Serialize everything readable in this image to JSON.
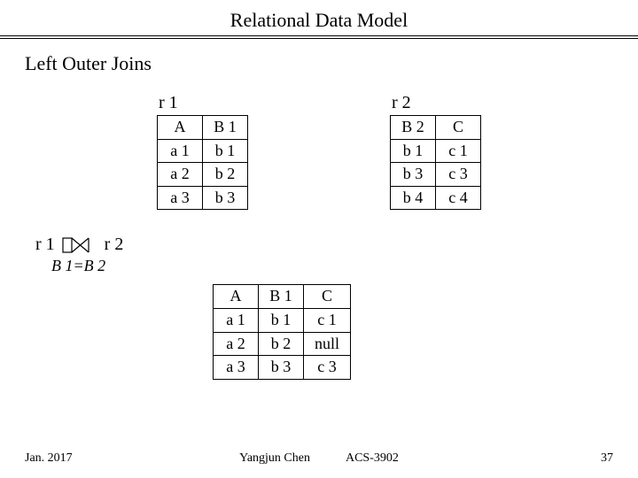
{
  "header": {
    "title": "Relational Data Model"
  },
  "section_title": "Left Outer Joins",
  "r1": {
    "label": "r 1",
    "cols": [
      "A",
      "B 1"
    ],
    "rows": [
      [
        "a 1",
        "b 1"
      ],
      [
        "a 2",
        "b 2"
      ],
      [
        "a 3",
        "b 3"
      ]
    ]
  },
  "r2": {
    "label": "r 2",
    "cols": [
      "B 2",
      "C"
    ],
    "rows": [
      [
        "b 1",
        "c 1"
      ],
      [
        "b 3",
        "c 3"
      ],
      [
        "b 4",
        "c 4"
      ]
    ]
  },
  "join": {
    "left": "r 1",
    "right": "r 2",
    "condition": "B 1=B 2"
  },
  "result": {
    "cols": [
      "A",
      "B 1",
      "C"
    ],
    "rows": [
      [
        "a 1",
        "b 1",
        "c 1"
      ],
      [
        "a 2",
        "b 2",
        "null"
      ],
      [
        "a 3",
        "b 3",
        "c 3"
      ]
    ]
  },
  "footer": {
    "date": "Jan. 2017",
    "author": "Yangjun Chen",
    "course": "ACS-3902",
    "page": "37"
  }
}
